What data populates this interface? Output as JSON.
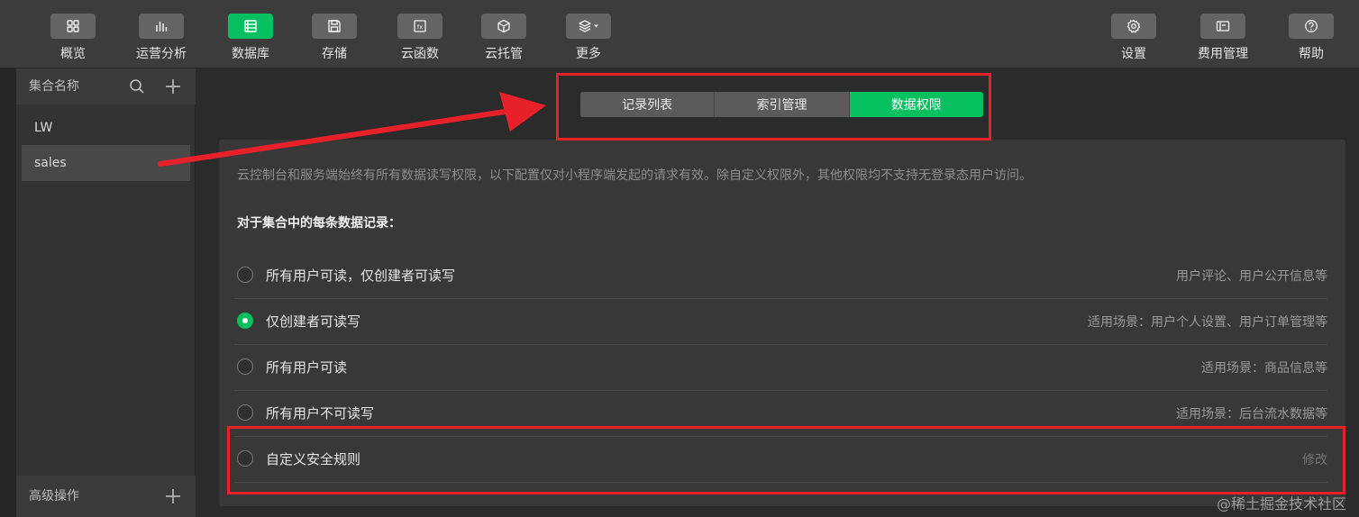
{
  "toolbar": {
    "left_items": [
      {
        "label": "概览",
        "icon": "grid-icon"
      },
      {
        "label": "运营分析",
        "icon": "bar-chart-icon"
      },
      {
        "label": "数据库",
        "icon": "database-icon"
      },
      {
        "label": "存储",
        "icon": "save-icon"
      },
      {
        "label": "云函数",
        "icon": "function-icon"
      },
      {
        "label": "云托管",
        "icon": "cube-icon"
      },
      {
        "label": "更多",
        "icon": "layers-dropdown-icon"
      }
    ],
    "right_items": [
      {
        "label": "设置",
        "icon": "gear-icon"
      },
      {
        "label": "费用管理",
        "icon": "billing-icon"
      },
      {
        "label": "帮助",
        "icon": "help-icon"
      }
    ],
    "active_label": "数据库",
    "accent_color": "#07c160"
  },
  "sidebar": {
    "header_title": "集合名称",
    "collections": [
      "LW",
      "sales"
    ],
    "selected": "sales",
    "footer_title": "高级操作"
  },
  "tabs": {
    "items": [
      "记录列表",
      "索引管理",
      "数据权限"
    ],
    "active": "数据权限"
  },
  "permissions": {
    "description": "云控制台和服务端始终有所有数据读写权限，以下配置仅对小程序端发起的请求有效。除自定义权限外，其他权限均不支持无登录态用户访问。",
    "subtitle": "对于集合中的每条数据记录：",
    "options": [
      {
        "label": "所有用户可读，仅创建者可读写",
        "hint": "用户评论、用户公开信息等",
        "checked": false
      },
      {
        "label": "仅创建者可读写",
        "hint": "适用场景：用户个人设置、用户订单管理等",
        "checked": true
      },
      {
        "label": "所有用户可读",
        "hint": "适用场景：商品信息等",
        "checked": false
      },
      {
        "label": "所有用户不可读写",
        "hint": "适用场景：后台流水数据等",
        "checked": false
      },
      {
        "label": "自定义安全规则",
        "hint": "修改",
        "checked": false
      }
    ]
  },
  "annotation_color": "#e8202a",
  "watermark": "@稀土掘金技术社区"
}
